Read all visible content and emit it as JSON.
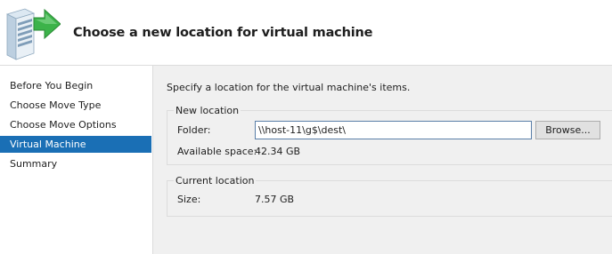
{
  "header": {
    "title": "Choose a new location for virtual machine",
    "icon": "server-with-green-arrow-icon"
  },
  "sidebar": {
    "items": [
      {
        "label": "Before You Begin",
        "selected": false
      },
      {
        "label": "Choose Move Type",
        "selected": false
      },
      {
        "label": "Choose Move Options",
        "selected": false
      },
      {
        "label": "Virtual Machine",
        "selected": true
      },
      {
        "label": "Summary",
        "selected": false
      }
    ],
    "selected_color": "#1a6fb5"
  },
  "main": {
    "intro": "Specify a location for the virtual machine's items.",
    "new_location": {
      "title": "New location",
      "folder_label": "Folder:",
      "folder_value": "\\\\host-11\\g$\\dest\\",
      "browse_label": "Browse...",
      "available_label": "Available space:",
      "available_value": "42.34 GB"
    },
    "current_location": {
      "title": "Current location",
      "size_label": "Size:",
      "size_value": "7.57 GB"
    }
  }
}
